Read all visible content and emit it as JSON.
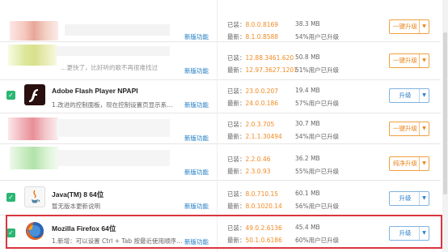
{
  "labels": {
    "installed": "已装：",
    "latest": "最新：",
    "new_feature": "新版功能"
  },
  "rows": [
    {
      "name": "",
      "desc": "",
      "installed": "8.0.0.8169",
      "latest": "8.1.0.8588",
      "size": "38.3 MB",
      "pct": "54%用户已升级",
      "button": "一键升级",
      "button_style": "orange",
      "newfeat": "新版功能"
    },
    {
      "name": "",
      "desc": "",
      "installed": "12.88.3461.620",
      "latest": "12.97.3627.1201",
      "size": "50.8 MB",
      "pct": "51%用户已升级",
      "button": "一键升级",
      "button_style": "orange",
      "newfeat": "新版功能",
      "desc_partial": "…更快了，比好听的歌不再很难找过"
    },
    {
      "name": "Adobe Flash Player NPAPI",
      "desc": "1.改进的控制面板，现在控制设置页显示系…",
      "installed": "23.0.0.207",
      "latest": "24.0.0.186",
      "size": "19.4 MB",
      "pct": "57%用户已升级",
      "button": "升级",
      "button_style": "blue",
      "newfeat": "新版功能"
    },
    {
      "name": "",
      "desc": "",
      "installed": "2.0.3.705",
      "latest": "2.1.1.30494",
      "size": "30.7 MB",
      "pct": "54%用户已升级",
      "button": "一键升级",
      "button_style": "orange",
      "newfeat": "新版功能"
    },
    {
      "name": "",
      "desc": "",
      "installed": "2.2.0.46",
      "latest": "2.3.0.93",
      "size": "36.2 MB",
      "pct": "55%用户已升级",
      "button": "纯净升级",
      "button_style": "orange",
      "newfeat": "新版功能"
    },
    {
      "name": "Java(TM) 8 64位",
      "desc": "暂无版本更新说明",
      "installed": "8.0.710.15",
      "latest": "8.0.1020.14",
      "size": "60.1 MB",
      "pct": "56%用户已升级",
      "button": "升级",
      "button_style": "blue",
      "newfeat": "新版功能"
    },
    {
      "name": "Mozilla Firefox 64位",
      "desc": "1.新增：可以设置 Ctrl + Tab 按最近使用顺序…",
      "installed": "49.0.2.6136",
      "latest": "50.1.0.6186",
      "size": "45.4 MB",
      "pct": "60%用户已升级",
      "button": "升级",
      "button_style": "blue",
      "newfeat": "新版功能"
    }
  ],
  "colors": {
    "accent_orange": "#f08a24",
    "link_blue": "#1a78c2",
    "check_green": "#2bb673",
    "highlight_red": "#d9363e"
  }
}
